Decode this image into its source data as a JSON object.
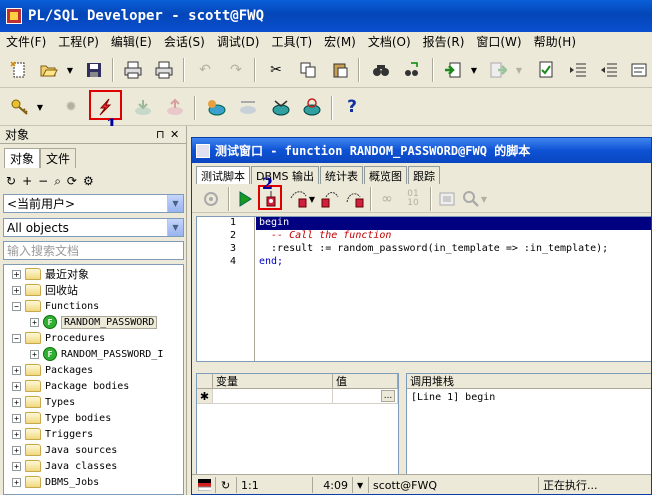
{
  "window": {
    "title": "PL/SQL Developer - scott@FWQ"
  },
  "menu": [
    "文件(F)",
    "工程(P)",
    "编辑(E)",
    "会话(S)",
    "调试(D)",
    "工具(T)",
    "宏(M)",
    "文档(O)",
    "报告(R)",
    "窗口(W)",
    "帮助(H)"
  ],
  "toolbar1": {
    "icons": [
      "new-icon",
      "open-icon",
      "save-icon",
      "print-icon",
      "print-preview-icon",
      "undo-icon",
      "redo-icon",
      "cut-icon",
      "copy-icon",
      "paste-icon",
      "find-icon",
      "find-next-icon",
      "import-icon",
      "export-icon",
      "execute-icon",
      "indent-icon",
      "unindent-icon"
    ]
  },
  "toolbar2": {
    "icons": [
      "key-icon",
      "gear-icon",
      "lightning-icon",
      "commit-icon",
      "rollback-icon",
      "session-icon",
      "connect-icon",
      "disconnect-icon",
      "db-refresh-icon",
      "help-icon"
    ],
    "help_glyph": "?"
  },
  "annotations": {
    "callout1": "1",
    "callout2": "2"
  },
  "objects_panel": {
    "title": "对象",
    "pin": "⊓",
    "close": "✕",
    "tabs": [
      "对象",
      "文件"
    ],
    "tools": [
      "↻",
      "+",
      "−",
      "⌕",
      "⟳",
      "⚙"
    ],
    "user_filter": "<当前用户>",
    "object_filter": "All objects",
    "search_placeholder": "输入搜索文档",
    "tree": [
      {
        "label": "最近对象",
        "level": 0,
        "type": "folder",
        "expander": "+"
      },
      {
        "label": "回收站",
        "level": 0,
        "type": "folder",
        "expander": "+"
      },
      {
        "label": "Functions",
        "level": 0,
        "type": "folder",
        "expander": "−"
      },
      {
        "label": "RANDOM_PASSWORD",
        "level": 1,
        "type": "function",
        "expander": "+",
        "selected": true
      },
      {
        "label": "Procedures",
        "level": 0,
        "type": "folder",
        "expander": "−"
      },
      {
        "label": "RANDOM_PASSWORD_I",
        "level": 1,
        "type": "function",
        "expander": "+"
      },
      {
        "label": "Packages",
        "level": 0,
        "type": "folder",
        "expander": "+"
      },
      {
        "label": "Package bodies",
        "level": 0,
        "type": "folder",
        "expander": "+"
      },
      {
        "label": "Types",
        "level": 0,
        "type": "folder",
        "expander": "+"
      },
      {
        "label": "Type bodies",
        "level": 0,
        "type": "folder",
        "expander": "+"
      },
      {
        "label": "Triggers",
        "level": 0,
        "type": "folder",
        "expander": "+"
      },
      {
        "label": "Java sources",
        "level": 0,
        "type": "folder",
        "expander": "+"
      },
      {
        "label": "Java classes",
        "level": 0,
        "type": "folder",
        "expander": "+"
      },
      {
        "label": "DBMS_Jobs",
        "level": 0,
        "type": "folder",
        "expander": "+"
      }
    ],
    "function_badge": "F"
  },
  "test_window": {
    "title": "测试窗口 - function RANDOM_PASSWORD@FWQ 的脚本",
    "tabs": [
      "测试脚本",
      "DBMS 输出",
      "统计表",
      "概览图",
      "跟踪"
    ],
    "code": [
      {
        "num": "1",
        "text": "begin"
      },
      {
        "num": "2",
        "text": "  -- Call the function"
      },
      {
        "num": "3",
        "text": "  :result := random_password(in_template => :in_template);"
      },
      {
        "num": "4",
        "text": "end;"
      }
    ],
    "variables": {
      "col_var": "变量",
      "col_val": "值",
      "row_marker": "✱",
      "ellipsis": "..."
    },
    "call_stack": {
      "header": "调用堆栈",
      "row": "[Line 1] begin"
    },
    "status": {
      "position": "1:1",
      "time": "4:09",
      "connection": "scott@FWQ",
      "state": "正在执行..."
    }
  }
}
